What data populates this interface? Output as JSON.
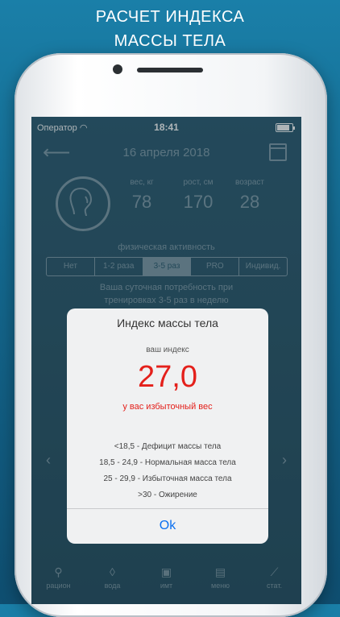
{
  "promo": {
    "line1": "РАСЧЕТ ИНДЕКСА",
    "line2": "МАССЫ ТЕЛА"
  },
  "status": {
    "carrier": "Оператор",
    "time": "18:41",
    "battery_percent": 90
  },
  "header": {
    "date": "16 апреля 2018"
  },
  "stats": [
    {
      "label": "вес, кг",
      "value": "78"
    },
    {
      "label": "рост, см",
      "value": "170"
    },
    {
      "label": "возраст",
      "value": "28"
    }
  ],
  "activity": {
    "label": "физическая активность",
    "options": [
      "Нет",
      "1-2 раза",
      "3-5 раз",
      "PRO",
      "Индивид."
    ],
    "selected": "3-5 раз"
  },
  "need_text": {
    "line1": "Ваша суточная потребность при",
    "line2": "тренировках 3-5 раз в неделю"
  },
  "tabs": [
    "рацион",
    "вода",
    "имт",
    "меню",
    "стат."
  ],
  "dialog": {
    "title": "Индекс массы тела",
    "subtitle": "ваш индекс",
    "index_value": "27,0",
    "verdict": "у вас избыточный вес",
    "ranges": [
      "<18,5 - Дефицит массы тела",
      "18,5 - 24,9 - Нормальная масса тела",
      "25 - 29,9 - Избыточная масса тела",
      ">30 - Ожирение"
    ],
    "ok_label": "Ok"
  },
  "colors": {
    "accent_red": "#e4201b",
    "ok_blue": "#0a6ff0"
  }
}
